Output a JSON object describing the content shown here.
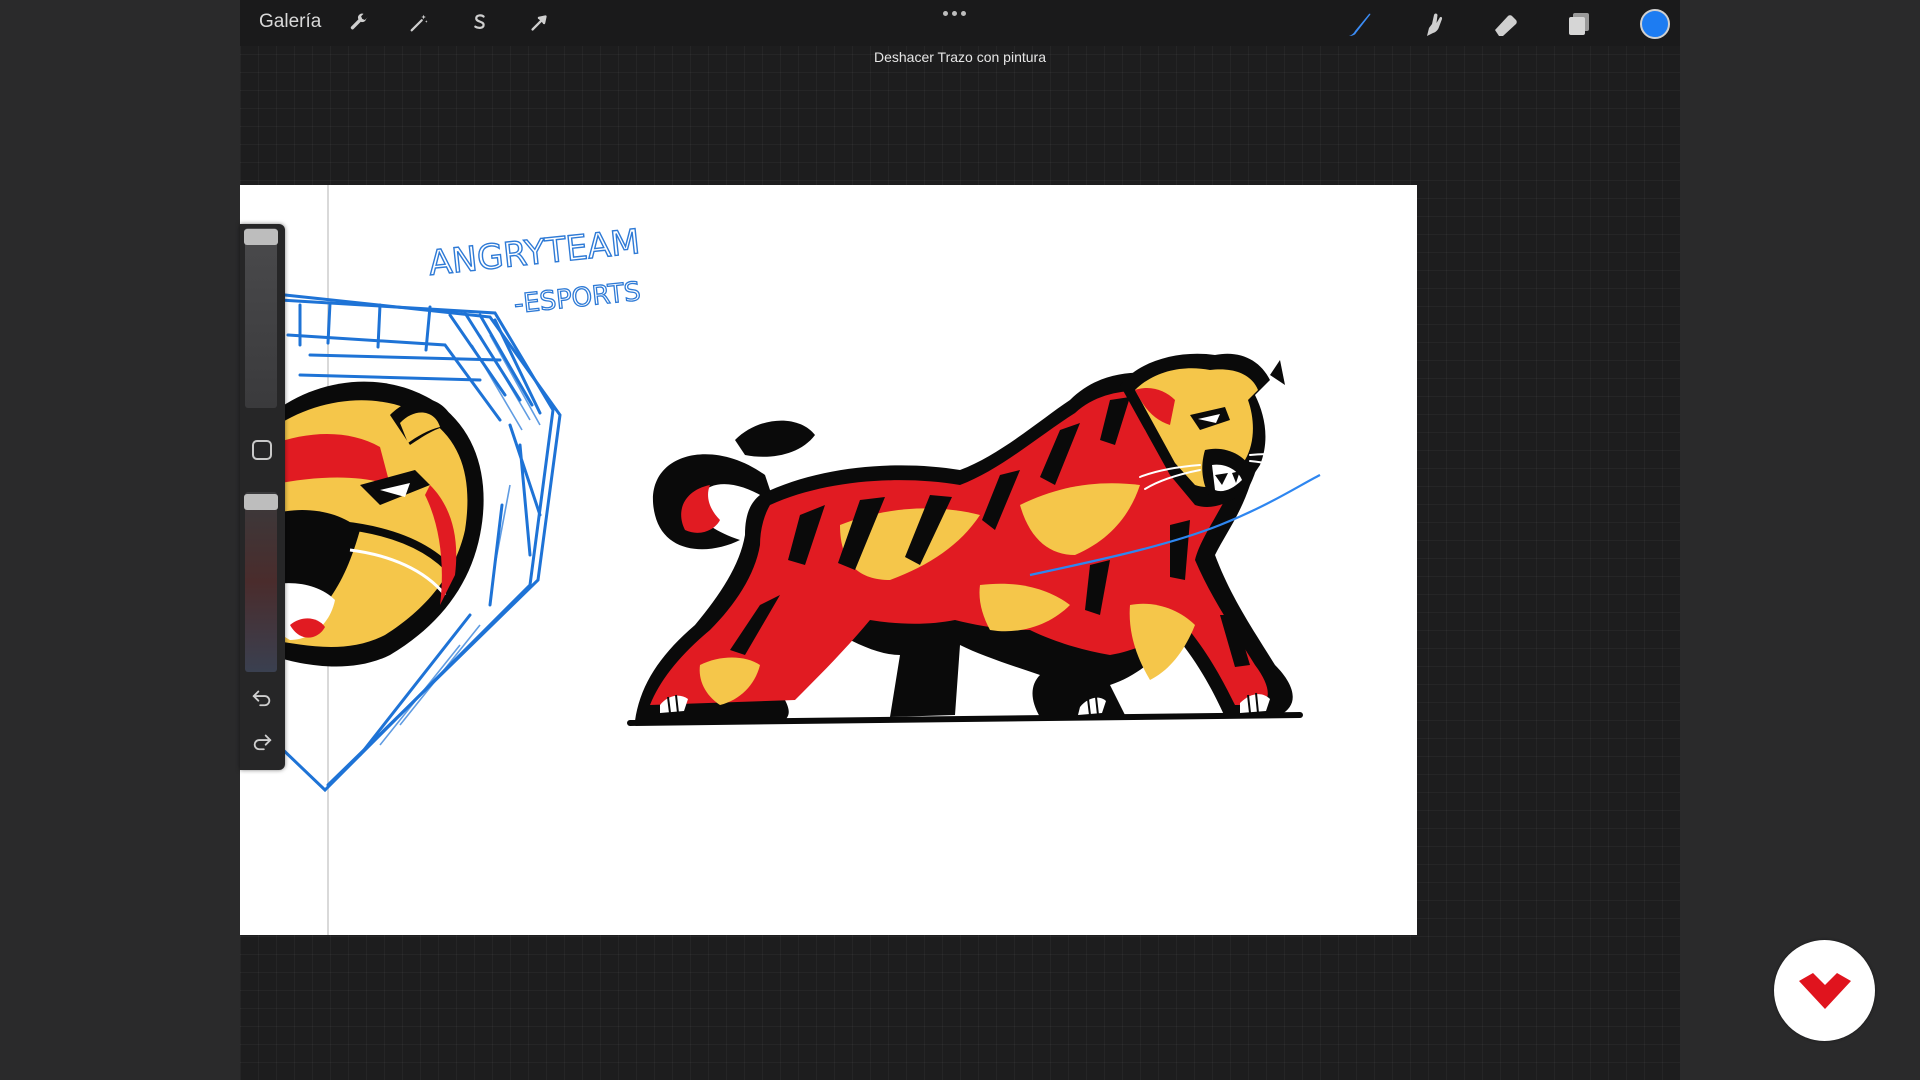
{
  "toolbar": {
    "gallery_label": "Galería",
    "left_tools": [
      {
        "name": "actions",
        "icon": "wrench-icon"
      },
      {
        "name": "adjustments",
        "icon": "magic-wand-icon"
      },
      {
        "name": "selection",
        "icon": "selection-s-icon"
      },
      {
        "name": "transform",
        "icon": "arrow-cursor-icon"
      }
    ],
    "more_icon": "ellipsis-icon",
    "right_tools": [
      {
        "name": "brush",
        "icon": "brush-icon",
        "active": true
      },
      {
        "name": "smudge",
        "icon": "smudge-finger-icon"
      },
      {
        "name": "eraser",
        "icon": "eraser-icon"
      },
      {
        "name": "layers",
        "icon": "layers-icon"
      }
    ],
    "current_color": "#1d7cf2"
  },
  "toast": {
    "message": "Deshacer Trazo con pintura"
  },
  "sidebar": {
    "brush_size_icon": "slider-thumb",
    "modify_icon": "square-icon",
    "opacity_icon": "slider-thumb",
    "undo_icon": "undo-icon",
    "redo_icon": "redo-icon"
  },
  "canvas": {
    "sketch_text_line1": "ANGRYTEAM",
    "sketch_text_line2": "-ESPORTS"
  },
  "colors": {
    "accent_blue": "#1d7cf2",
    "tiger_red": "#e11b22",
    "tiger_yellow": "#f5c64a",
    "ink_black": "#0a0a0a",
    "sketch_blue": "#1e73d6"
  },
  "watermark": {
    "icon": "brand-logo-icon"
  }
}
